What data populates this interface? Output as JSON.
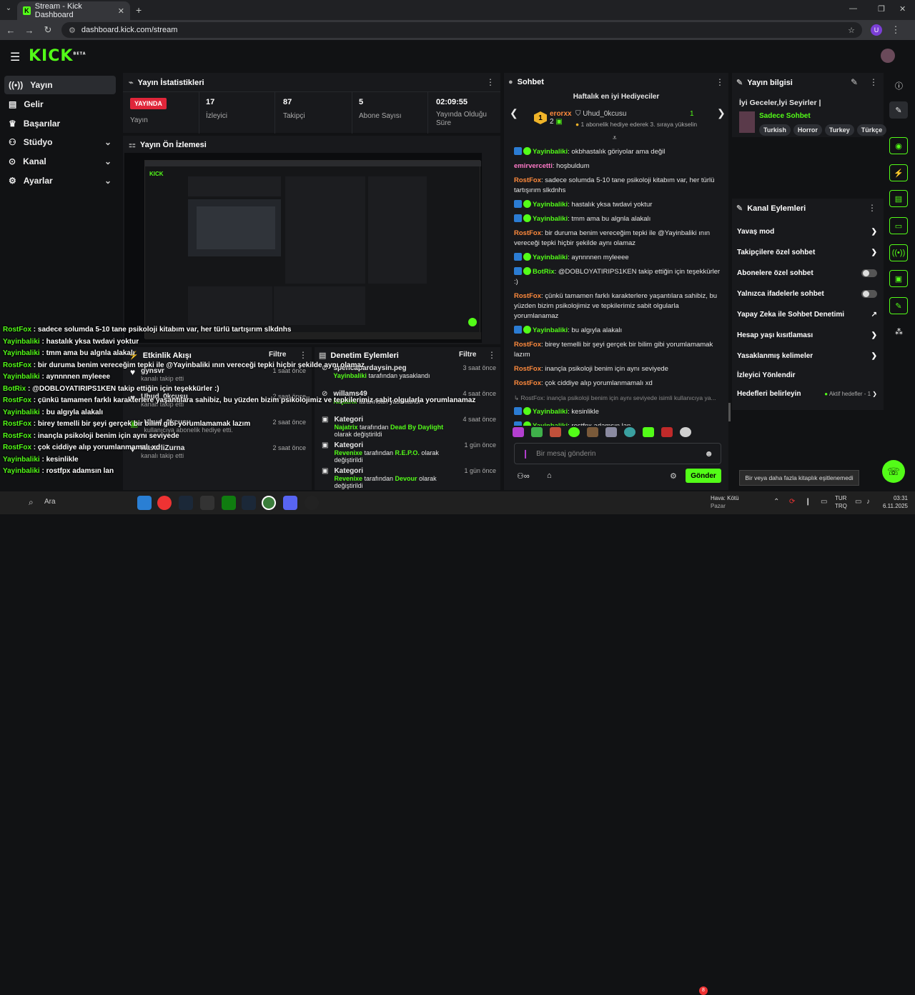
{
  "browser": {
    "tab_title": "Stream - Kick Dashboard",
    "url": "dashboard.kick.com/stream",
    "profile_initial": "U"
  },
  "logo": {
    "text": "KICK",
    "superscript": "BETA"
  },
  "nav": [
    {
      "label": "Yayın",
      "icon": "signal-icon"
    },
    {
      "label": "Gelir",
      "icon": "income-icon"
    },
    {
      "label": "Başarılar",
      "icon": "trophy-icon"
    },
    {
      "label": "Stüdyo",
      "icon": "studio-icon"
    },
    {
      "label": "Kanal",
      "icon": "channel-icon"
    },
    {
      "label": "Ayarlar",
      "icon": "gear-icon"
    }
  ],
  "stats": {
    "title": "Yayın İstatistikleri",
    "live_badge": "YAYINDA",
    "live_label": "Yayın",
    "viewers_value": "17",
    "viewers_label": "İzleyici",
    "followers_value": "87",
    "followers_label": "Takipçi",
    "subs_value": "5",
    "subs_label": "Abone Sayısı",
    "duration_value": "02:09:55",
    "duration_label": "Yayında Olduğu Süre"
  },
  "preview": {
    "title": "Yayın Ön İzlemesi"
  },
  "chat": {
    "title": "Sohbet",
    "gifters_title": "Haftalık en iyi Hediyeciler",
    "gifter_name": "erorxx",
    "gifter_count": "2",
    "gifter_rank": "1",
    "second_gifter": "Uhud_0kcusu",
    "second_count": "1",
    "gift_hint": "1 abonelik hediye ederek 3. sıraya yükselin",
    "messages": [
      {
        "user": "Yayinbaliki",
        "text": "okbhastalık göriyolar ama değil",
        "color": "green",
        "badge": true
      },
      {
        "user": "emirvercetti",
        "text": "hoşbuldum",
        "color": "pink",
        "badge": false
      },
      {
        "user": "RostFox",
        "text": "sadece solumda 5-10 tane psikoloji kitabım var, her türlü tartışırım slkdnhs",
        "color": "orange",
        "badge": false
      },
      {
        "user": "Yayinbaliki",
        "text": "hastalık yksa twdavi yoktur",
        "color": "green",
        "badge": true
      },
      {
        "user": "Yayinbaliki",
        "text": "tmm ama bu algnla alakalı",
        "color": "green",
        "badge": true
      },
      {
        "user": "RostFox",
        "text": "bir duruma benim vereceğim tepki ile @Yayinbaliki ının vereceği tepki hiçbir şekilde aynı olamaz",
        "color": "orange",
        "badge": false
      },
      {
        "user": "Yayinbaliki",
        "text": "aynnnnen myleeee",
        "color": "green",
        "badge": true
      },
      {
        "user": "BotRix",
        "text": "@DOBLOYATIRIPS1KEN takip ettiğin için teşekkürler :)",
        "color": "green",
        "badge": true
      },
      {
        "user": "RostFox",
        "text": "çünkü tamamen farklı karakterlere yaşantılara sahibiz, bu yüzden bizim psikolojimiz ve tepkilerimiz sabit olgularla yorumlanamaz",
        "color": "orange",
        "badge": false
      },
      {
        "user": "Yayinbaliki",
        "text": "bu algıyla alakalı",
        "color": "green",
        "badge": true
      },
      {
        "user": "RostFox",
        "text": "birey temelli bir şeyi gerçek bir bilim gibi yorumlamamak lazım",
        "color": "orange",
        "badge": false
      },
      {
        "user": "RostFox",
        "text": "inançla psikoloji benim için aynı seviyede",
        "color": "orange",
        "badge": false
      },
      {
        "user": "RostFox",
        "text": "çok ciddiye alıp yorumlanmamalı xd",
        "color": "orange",
        "badge": false
      }
    ],
    "reply_preview": "↳ RostFox: inançla psikoloji benim için aynı seviyede isimli kullanıcıya ya...",
    "messages_after": [
      {
        "user": "Yayinbaliki",
        "text": "kesinlikle",
        "color": "green",
        "badge": true
      },
      {
        "user": "Yayinbaliki",
        "text": "rostfpx adamsın lan",
        "color": "green",
        "badge": true
      }
    ],
    "input_placeholder": "Bir mesaj gönderin",
    "send_label": "Gönder"
  },
  "stream_info": {
    "title": "Yayın bilgisi",
    "stream_title": "İyi Geceler,İyi Seyirler |",
    "category": "Sadece Sohbet",
    "tags": [
      "Turkish",
      "Horror",
      "Turkey",
      "Türkçe"
    ]
  },
  "channel_actions": {
    "title": "Kanal Eylemleri",
    "items": [
      {
        "label": "Yavaş mod",
        "control": "chevron"
      },
      {
        "label": "Takipçilere özel sohbet",
        "control": "chevron"
      },
      {
        "label": "Abonelere özel sohbet",
        "control": "toggle"
      },
      {
        "label": "Yalnızca ifadelerle sohbet",
        "control": "toggle"
      },
      {
        "label": "Yapay Zeka ile Sohbet Denetimi",
        "control": "external"
      },
      {
        "label": "Hesap yaşı kısıtlaması",
        "control": "chevron"
      },
      {
        "label": "Yasaklanmış kelimeler",
        "control": "chevron"
      },
      {
        "label": "İzleyici Yönlendir",
        "control": "none"
      },
      {
        "label": "Hedefleri belirleyin",
        "control": "chevron"
      }
    ],
    "goals_status": "Aktif hedefler - 1"
  },
  "activity": {
    "title": "Etkinlik Akışı",
    "filter": "Filtre",
    "items": [
      {
        "name": "gynsvr",
        "sub": "kanalı takip etti",
        "time": "1 saat önce"
      },
      {
        "name": "Uhud_0kcusu",
        "sub": "kanalı takip etti",
        "time": "2 saat önce"
      },
      {
        "name": "Uhud_0kcusu",
        "sub": "kullanıcıya abonelik hediye etti.",
        "time": "2 saat önce"
      },
      {
        "name": "KasarliZurna",
        "sub": "kanalı takip etti",
        "time": "2 saat önce"
      }
    ]
  },
  "moderation": {
    "title": "Denetim Eylemleri",
    "filter": "Filtre",
    "items": [
      {
        "name": "spencapardaysin.peg",
        "mod": "Yayinbaliki",
        "action": "tarafından yasaklandı",
        "extra": "",
        "extra2": "",
        "time": "3 saat önce"
      },
      {
        "name": "willams49",
        "mod": "Najatrix",
        "action": "tarafından yasaklandı",
        "extra": "",
        "extra2": "",
        "time": "4 saat önce"
      },
      {
        "name": "Kategori",
        "mod": "Najatrix",
        "action": "tarafından",
        "extra": "Dead By Daylight",
        "extra2": "olarak değiştirildi",
        "time": "4 saat önce"
      },
      {
        "name": "Kategori",
        "mod": "Revenixe",
        "action": "tarafından",
        "extra": "R.E.P.O.",
        "extra2": "olarak değiştirildi",
        "time": "1 gün önce"
      },
      {
        "name": "Kategori",
        "mod": "Revenixe",
        "action": "tarafından",
        "extra": "Devour",
        "extra2": "olarak değiştirildi",
        "time": "1 gün önce"
      }
    ]
  },
  "overlay_chat": [
    {
      "user": "RostFox",
      "text": "sadece solumda 5-10 tane psikoloji kitabım var, her türlü tartışırım slkdnhs"
    },
    {
      "user": "Yayinbaliki",
      "text": "hastalık yksa twdavi yoktur"
    },
    {
      "user": "Yayinbaliki",
      "text": "tmm ama bu algnla alakalı"
    },
    {
      "user": "RostFox",
      "text": "bir duruma benim vereceğim tepki ile @Yayinbaliki ının vereceği tepki hiçbir şekilde aynı olamaz"
    },
    {
      "user": "Yayinbaliki",
      "text": "aynnnnen myleeee"
    },
    {
      "user": "BotRix",
      "text": "@DOBLOYATIRIPS1KEN takip ettiğin için teşekkürler :)"
    },
    {
      "user": "RostFox",
      "text": "çünkü tamamen farklı karakterlere yaşantılara sahibiz, bu yüzden bizim psikolojimiz ve tepkilerimiz sabit olgularla yorumlanamaz"
    },
    {
      "user": "Yayinbaliki",
      "text": "bu algıyla alakalı"
    },
    {
      "user": "RostFox",
      "text": "birey temelli bir şeyi gerçek bir bilim gibi yorumlamamak lazım"
    },
    {
      "user": "RostFox",
      "text": "inançla psikoloji benim için aynı seviyede"
    },
    {
      "user": "RostFox",
      "text": "çok ciddiye alıp yorumlanmamalı xd"
    },
    {
      "user": "Yayinbaliki",
      "text": "kesinlikle"
    },
    {
      "user": "Yayinbaliki",
      "text": "rostfpx adamsın lan"
    }
  ],
  "tooltip": "Bir veya daha fazla kitaplık eşitlenemedi",
  "taskbar": {
    "search": "Ara",
    "weather": "Hava: Kötü",
    "weather_sub": "Pazar",
    "weather_badge": "8",
    "lang1": "TUR",
    "lang2": "TRQ",
    "time": "03:31",
    "date": "6.11.2025"
  },
  "colors": {
    "accent": "#53fc18",
    "background": "#111214",
    "panel": "#18191c",
    "orange_user": "#ff8a3d"
  }
}
